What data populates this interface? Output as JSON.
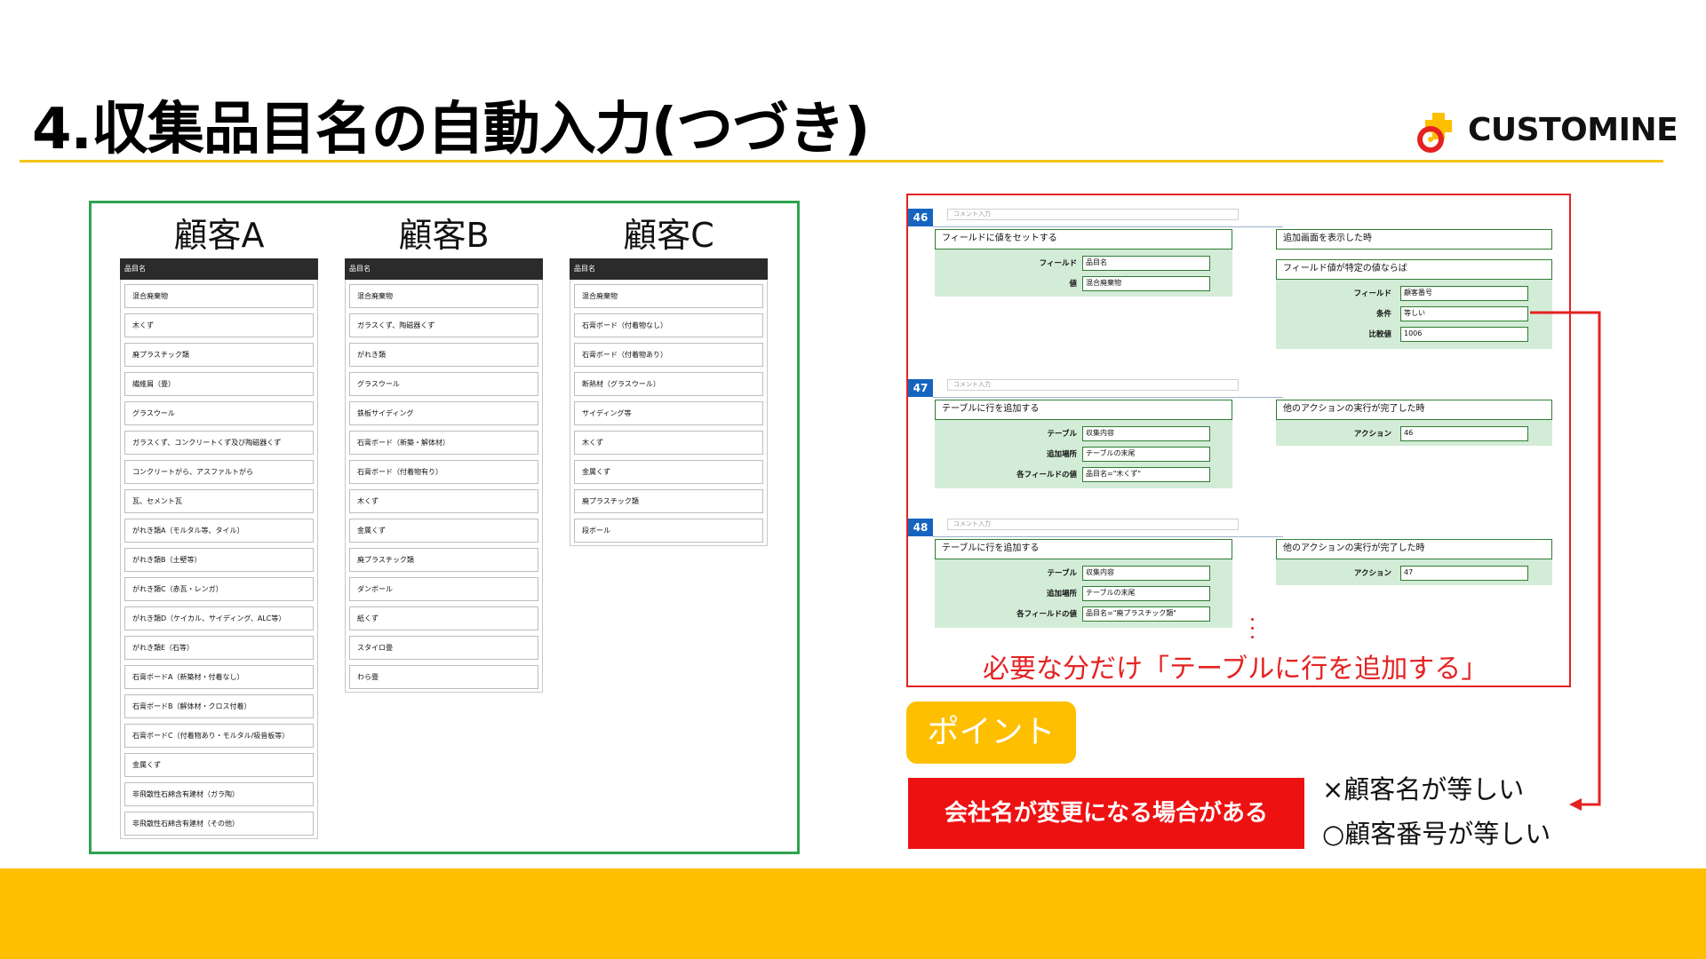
{
  "slide": {
    "title": "4.収集品目名の自動入力(つづき)",
    "logo_text": "CUSTOMINE",
    "colors": {
      "accent": "#fdbf00",
      "red": "#ee1111",
      "green": "#2ea44f",
      "blue": "#1565c0"
    }
  },
  "customers": [
    {
      "name": "顧客A",
      "header": "品目名",
      "items": [
        "混合廃棄物",
        "木くず",
        "廃プラスチック類",
        "繊維屑（畳）",
        "グラスウール",
        "ガラスくず、コンクリートくず及び陶磁器くず",
        "コンクリートがら、アスファルトがら",
        "瓦、セメント瓦",
        "がれき類A（モルタル等、タイル）",
        "がれき類B（土壁等）",
        "がれき類C（赤瓦・レンガ）",
        "がれき類D（ケイカル、サイディング、ALC等）",
        "がれき類E（石等）",
        "石膏ボードA（新築材・付着なし）",
        "石膏ボードB（解体材・クロス付着）",
        "石膏ボードC（付着物あり・モルタル/吸音板等）",
        "金属くず",
        "非飛散性石綿含有建材（ガラ陶）",
        "非飛散性石綿含有建材（その他）"
      ]
    },
    {
      "name": "顧客B",
      "header": "品目名",
      "items": [
        "混合廃棄物",
        "ガラスくず、陶磁器くず",
        "がれき類",
        "グラスウール",
        "鉄板サイディング",
        "石膏ボード（新築・解体材）",
        "石膏ボード（付着物有り）",
        "木くず",
        "金属くず",
        "廃プラスチック類",
        "ダンボール",
        "紙くず",
        "スタイロ畳",
        "わら畳"
      ]
    },
    {
      "name": "顧客C",
      "header": "品目名",
      "items": [
        "混合廃棄物",
        "石膏ボード（付着物なし）",
        "石膏ボード（付着物あり）",
        "断熱材（グラスウール）",
        "サイディング等",
        "木くず",
        "金属くず",
        "廃プラスチック類",
        "段ボール"
      ]
    }
  ],
  "rules": [
    {
      "number": "46",
      "comment": "コメント入力",
      "action_title": "フィールドに値をセットする",
      "action_fields": [
        {
          "label": "フィールド",
          "value": "品目名"
        },
        {
          "label": "値",
          "value": "混合廃棄物"
        }
      ],
      "trigger_title": "追加画面を表示した時",
      "condition_title": "フィールド値が特定の値ならば",
      "condition_fields": [
        {
          "label": "フィールド",
          "value": "顧客番号"
        },
        {
          "label": "条件",
          "value": "等しい"
        },
        {
          "label": "比較値",
          "value": "1006"
        }
      ]
    },
    {
      "number": "47",
      "comment": "コメント入力",
      "action_title": "テーブルに行を追加する",
      "action_fields": [
        {
          "label": "テーブル",
          "value": "収集内容"
        },
        {
          "label": "追加場所",
          "value": "テーブルの末尾"
        },
        {
          "label": "各フィールドの値",
          "value": "品目名=\"木くず\""
        }
      ],
      "trigger_title": "他のアクションの実行が完了した時",
      "trigger_fields": [
        {
          "label": "アクション",
          "value": "46"
        }
      ]
    },
    {
      "number": "48",
      "comment": "コメント入力",
      "action_title": "テーブルに行を追加する",
      "action_fields": [
        {
          "label": "テーブル",
          "value": "収集内容"
        },
        {
          "label": "追加場所",
          "value": "テーブルの末尾"
        },
        {
          "label": "各フィールドの値",
          "value": "品目名=\"廃プラスチック類\""
        }
      ],
      "trigger_title": "他のアクションの実行が完了した時",
      "trigger_fields": [
        {
          "label": "アクション",
          "value": "47"
        }
      ]
    }
  ],
  "note": "必要な分だけ「テーブルに行を追加する」",
  "point": {
    "label": "ポイント",
    "warning": "会社名が変更になる場合がある",
    "bad": "×顧客名が等しい",
    "good": "○顧客番号が等しい"
  }
}
